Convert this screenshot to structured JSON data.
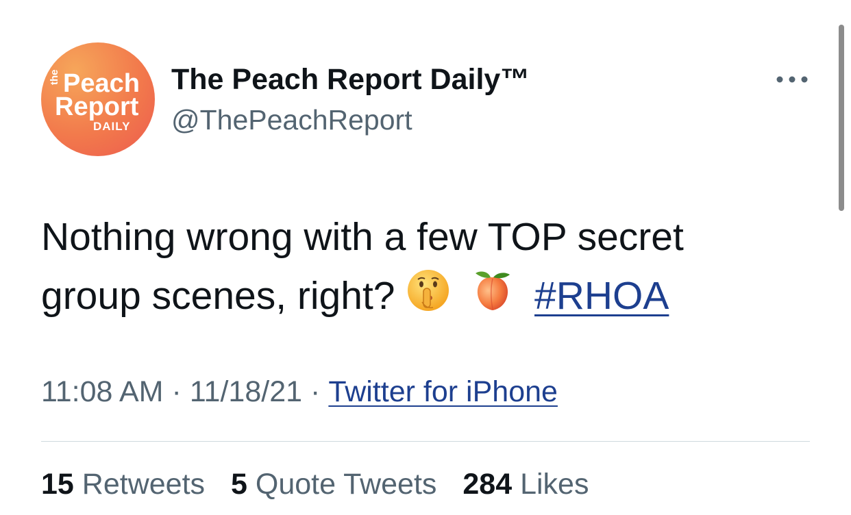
{
  "account": {
    "avatar": {
      "logo_text": {
        "the": "the",
        "peach": "Peach",
        "report": "Report",
        "daily": "DAILY"
      },
      "colors": {
        "from": "#f6a65a",
        "to": "#ec5a4e"
      }
    },
    "display_name": "The Peach Report Daily™",
    "handle": "@ThePeachReport"
  },
  "more_menu": {
    "icon": "more-horizontal-icon"
  },
  "tweet": {
    "line1": "Nothing wrong with a few TOP secret",
    "line2": "group scenes, right?",
    "emojis": [
      "shushing-face-icon",
      "peach-icon"
    ],
    "hashtag": "#RHOA"
  },
  "meta": {
    "time": "11:08 AM",
    "separator": "·",
    "date": "11/18/21",
    "source": "Twitter for iPhone"
  },
  "stats": {
    "retweets": {
      "count": "15",
      "label": "Retweets"
    },
    "quotes": {
      "count": "5",
      "label": "Quote Tweets"
    },
    "likes": {
      "count": "284",
      "label": "Likes"
    }
  },
  "colors": {
    "text": "#0f1419",
    "secondary": "#536471",
    "link": "#1d3f8f",
    "divider": "#cfd9de"
  }
}
